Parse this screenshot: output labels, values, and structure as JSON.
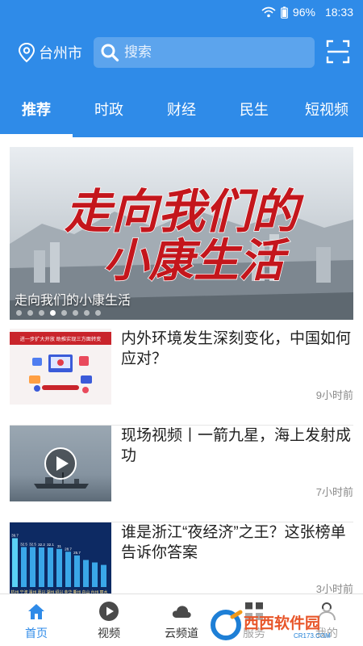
{
  "status_bar": {
    "battery": "96%",
    "time": "18:33"
  },
  "header": {
    "location": "台州市",
    "search_placeholder": "搜索"
  },
  "tabs": [
    {
      "label": "推荐",
      "active": true
    },
    {
      "label": "时政",
      "active": false
    },
    {
      "label": "财经",
      "active": false
    },
    {
      "label": "民生",
      "active": false
    },
    {
      "label": "短视频",
      "active": false
    }
  ],
  "banner": {
    "headline_line1": "走向我们的",
    "headline_line2": "小康生活",
    "caption": "走向我们的小康生活",
    "slide_count": 8,
    "active_slide": 3
  },
  "news": [
    {
      "title": "内外环境发生深刻变化，中国如何应对？",
      "time": "9小时前",
      "thumb_text": "进一步扩大开放 助推实现三方面转变"
    },
    {
      "title": "现场视频丨一箭九星，海上发射成功",
      "time": "7小时前"
    },
    {
      "title": "谁是浙江“夜经济”之王？这张榜单告诉你答案",
      "time": "3小时前",
      "thumb_values": [
        "39.7",
        "32.5",
        "32.5",
        "32.2",
        "32.1",
        "31",
        "28.7",
        "25.7"
      ],
      "thumb_cities": [
        "杭州",
        "宁波",
        "温州",
        "嘉兴",
        "湖州",
        "绍兴",
        "金华",
        "衢州",
        "舟山",
        "台州",
        "丽水"
      ]
    }
  ],
  "bottom_nav": [
    {
      "label": "首页",
      "icon": "home-icon",
      "active": true
    },
    {
      "label": "视频",
      "icon": "play-icon",
      "active": false
    },
    {
      "label": "云频道",
      "icon": "cloud-icon",
      "active": false
    },
    {
      "label": "服务",
      "icon": "grid-icon",
      "active": false
    },
    {
      "label": "我的",
      "icon": "user-icon",
      "active": false
    }
  ],
  "watermark": {
    "text": "西西软件园",
    "subtext": "CR173.COM"
  },
  "colors": {
    "primary": "#2f8be8",
    "banner_text": "#c4161c"
  }
}
